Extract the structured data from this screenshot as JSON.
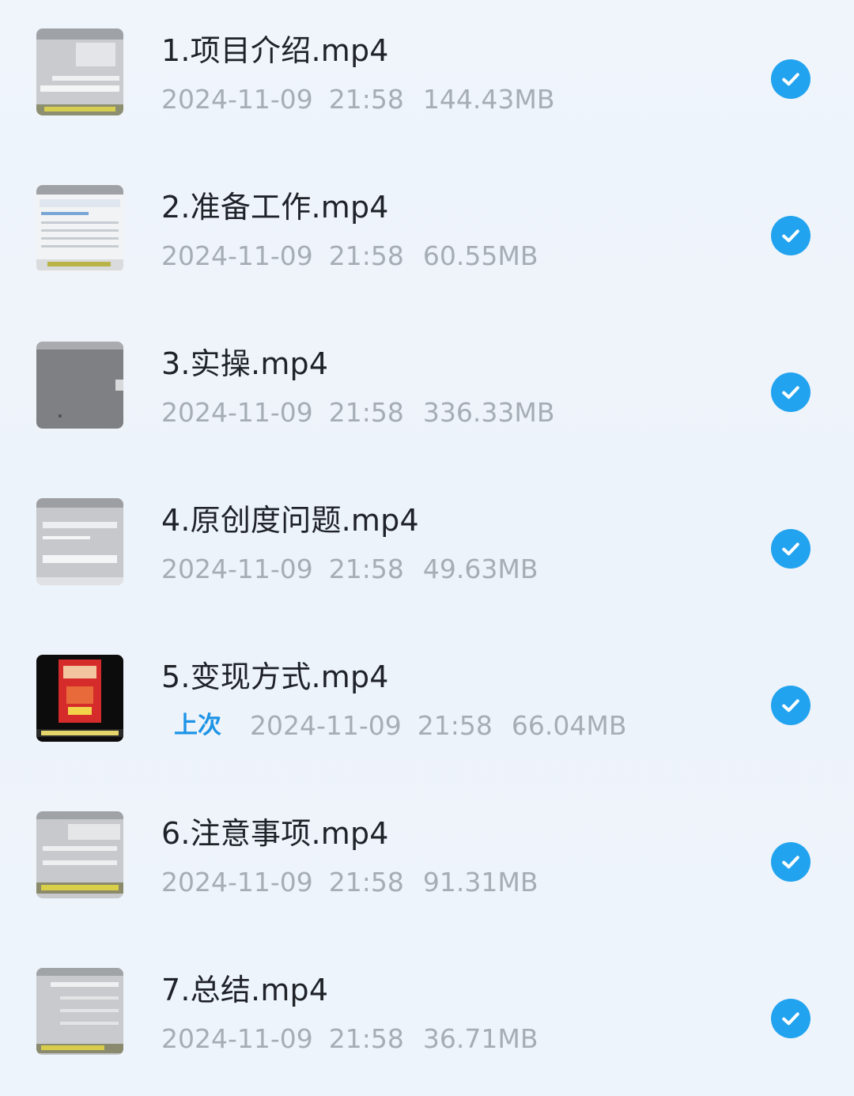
{
  "files": [
    {
      "name": "1.项目介绍.mp4",
      "date": "2024-11-09",
      "time": "21:58",
      "size": "144.43MB",
      "thumbnail_icon": "video-thumbnail",
      "status_icon": "check-circle-icon"
    },
    {
      "name": "2.准备工作.mp4",
      "date": "2024-11-09",
      "time": "21:58",
      "size": "60.55MB",
      "thumbnail_icon": "video-thumbnail",
      "status_icon": "check-circle-icon"
    },
    {
      "name": "3.实操.mp4",
      "date": "2024-11-09",
      "time": "21:58",
      "size": "336.33MB",
      "thumbnail_icon": "video-thumbnail",
      "status_icon": "check-circle-icon"
    },
    {
      "name": "4.原创度问题.mp4",
      "date": "2024-11-09",
      "time": "21:58",
      "size": "49.63MB",
      "thumbnail_icon": "video-thumbnail",
      "status_icon": "check-circle-icon"
    },
    {
      "name": "5.变现方式.mp4",
      "badge": "上次",
      "date": "2024-11-09",
      "time": "21:58",
      "size": "66.04MB",
      "thumbnail_icon": "video-thumbnail",
      "status_icon": "check-circle-icon"
    },
    {
      "name": "6.注意事项.mp4",
      "date": "2024-11-09",
      "time": "21:58",
      "size": "91.31MB",
      "thumbnail_icon": "video-thumbnail",
      "status_icon": "check-circle-icon"
    },
    {
      "name": "7.总结.mp4",
      "date": "2024-11-09",
      "time": "21:58",
      "size": "36.71MB",
      "thumbnail_icon": "video-thumbnail",
      "status_icon": "check-circle-icon"
    }
  ],
  "colors": {
    "background": "#eef4fb",
    "title_text": "#1f2329",
    "meta_text": "#a7adb5",
    "badge_text": "#1e94e6",
    "check_fill": "#22a3ef"
  }
}
